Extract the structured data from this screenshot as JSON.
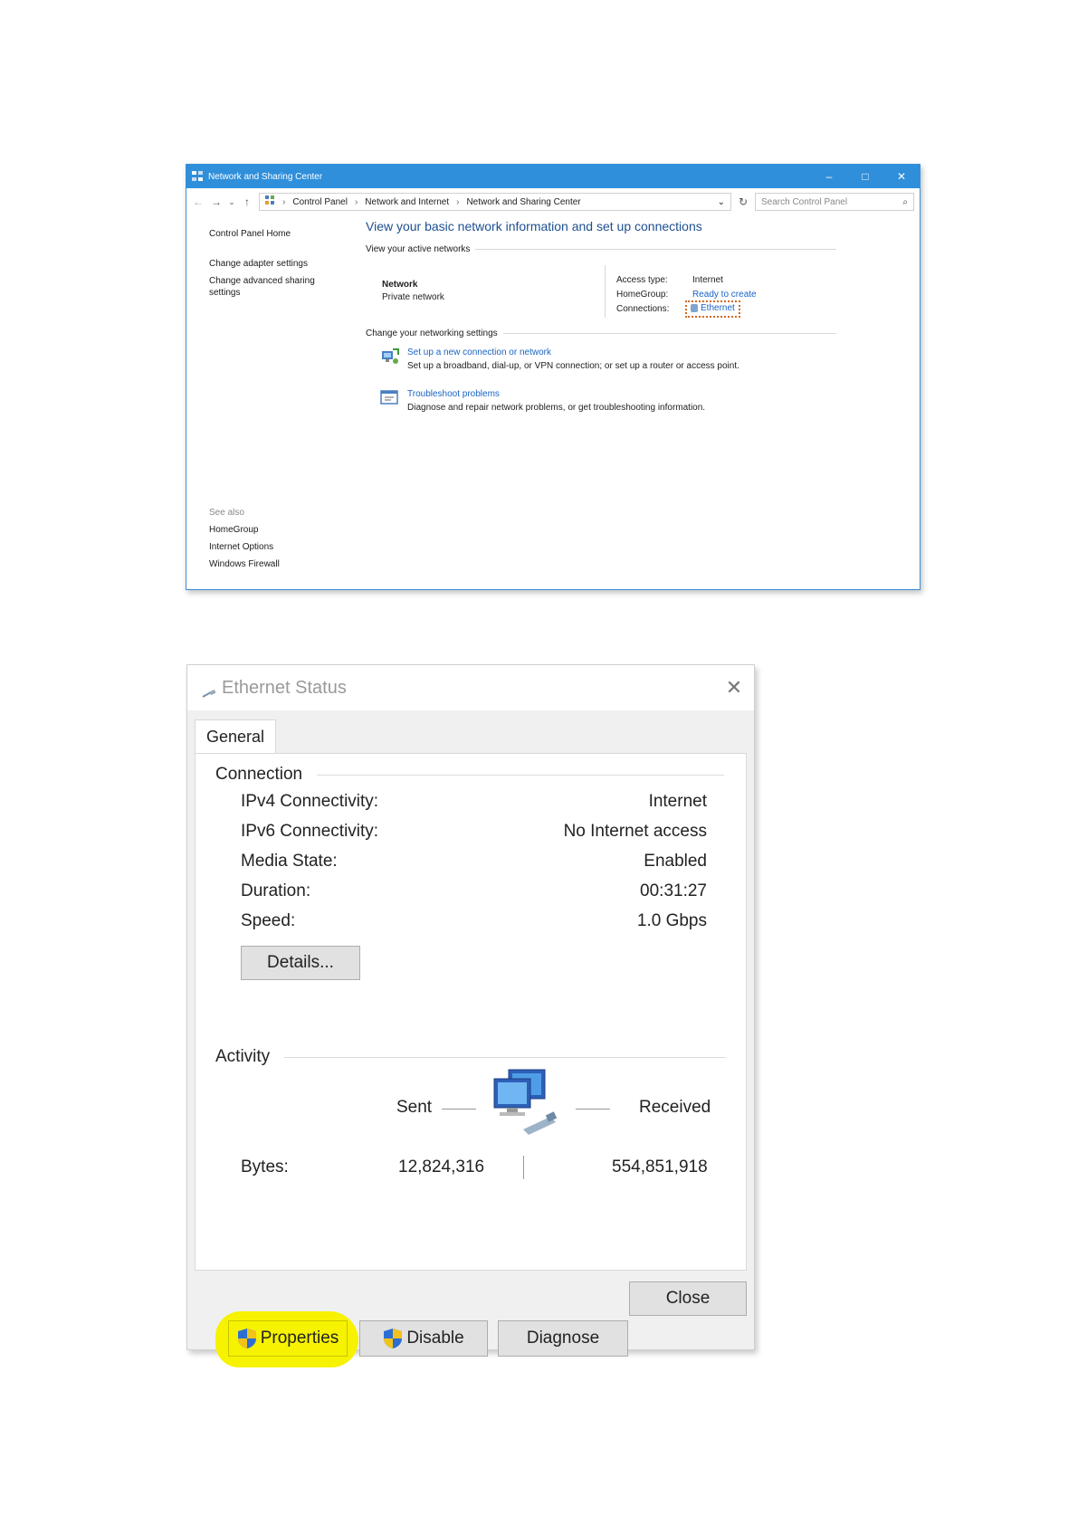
{
  "nsc": {
    "window_title": "Network and Sharing Center",
    "controls": {
      "minimize": "–",
      "maximize": "□",
      "close": "✕"
    },
    "address": {
      "back": "←",
      "forward": "→",
      "dropdown": "⌄",
      "up": "↑",
      "crumb1": "Control Panel",
      "crumb2": "Network and Internet",
      "crumb3": "Network and Sharing Center",
      "chevron": "›",
      "addr_dropdown": "⌄",
      "refresh": "↻",
      "search_placeholder": "Search Control Panel",
      "search_glyph": "⌕"
    },
    "left_nav": {
      "home": "Control Panel Home",
      "adapter": "Change adapter settings",
      "advanced": "Change advanced sharing settings"
    },
    "see_also": {
      "header": "See also",
      "homegroup": "HomeGroup",
      "internet_options": "Internet Options",
      "firewall": "Windows Firewall"
    },
    "main": {
      "heading": "View your basic network information and set up connections",
      "active_networks": "View your active networks",
      "network_name": "Network",
      "network_type": "Private network",
      "access_type_label": "Access type:",
      "access_type_value": "Internet",
      "homegroup_label": "HomeGroup:",
      "homegroup_value": "Ready to create",
      "connections_label": "Connections:",
      "connections_value": "Ethernet",
      "change_settings": "Change your networking settings",
      "task1_link": "Set up a new connection or network",
      "task1_desc": "Set up a broadband, dial-up, or VPN connection; or set up a router or access point.",
      "task2_link": "Troubleshoot problems",
      "task2_desc": "Diagnose and repair network problems, or get troubleshooting information."
    }
  },
  "eth": {
    "title": "Ethernet Status",
    "close_glyph": "✕",
    "tab": "General",
    "connection": {
      "header": "Connection",
      "ipv4_label": "IPv4 Connectivity:",
      "ipv4_value": "Internet",
      "ipv6_label": "IPv6 Connectivity:",
      "ipv6_value": "No Internet access",
      "media_label": "Media State:",
      "media_value": "Enabled",
      "duration_label": "Duration:",
      "duration_value": "00:31:27",
      "speed_label": "Speed:",
      "speed_value": "1.0 Gbps"
    },
    "details_button": "Details...",
    "activity": {
      "header": "Activity",
      "sent": "Sent",
      "received": "Received",
      "bytes_label": "Bytes:",
      "bytes_sent": "12,824,316",
      "bytes_received": "554,851,918"
    },
    "buttons": {
      "properties": "Properties",
      "disable": "Disable",
      "diagnose": "Diagnose",
      "close": "Close"
    },
    "highlight_color": "#f7f200"
  }
}
